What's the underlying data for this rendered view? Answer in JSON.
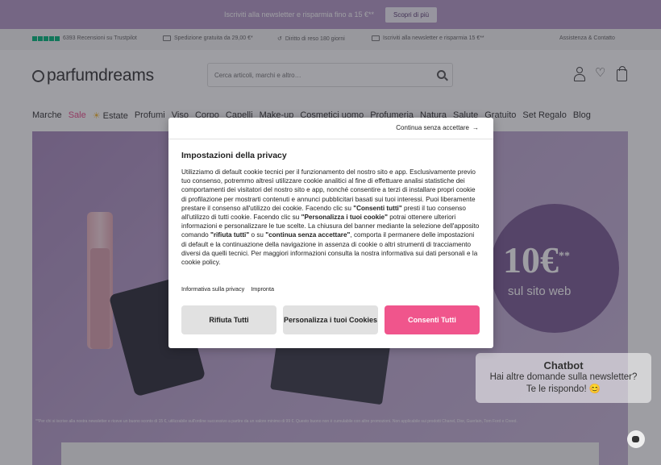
{
  "top_banner": {
    "text": "Iscriviti alla newsletter e risparmia fino a 15 €**",
    "button": "Scopri di più"
  },
  "info_bar": {
    "reviews": "6393 Recensioni su Trustpilot",
    "shipping": "Spedizione gratuita da 29,00 €*",
    "returns": "Diritto di reso 180 giorni",
    "newsletter": "Iscriviti alla newsletter e risparmia 15 €**",
    "support": "Assistenza & Contatto"
  },
  "header": {
    "logo": "parfumdreams",
    "search_placeholder": "Cerca articoli, marchi e altro…"
  },
  "nav": {
    "items": [
      "Marche",
      "Sale",
      "Estate",
      "Profumi",
      "Viso",
      "Corpo",
      "Capelli",
      "Make-up",
      "Cosmetici uomo",
      "Profumeria",
      "Natura",
      "Salute",
      "Gratuito",
      "Set Regalo",
      "Blog"
    ]
  },
  "hero": {
    "amount": "10€",
    "amount_sup": "**",
    "subtitle": "sul sito web",
    "fine_print": "**Per chi si iscrive alla nostra newsletter e riceve un buono sconto di 15 €, utilizzabile sull'ordine successivo a partire da un valore minimo di 99 €. Questo buono non è cumulabile con altre promozioni. Non applicabile sui prodotti Chanel, Dior, Guerlain, Tom Ford e Creed."
  },
  "chatbot": {
    "title": "Chatbot",
    "line1": "Hai altre domande sulla newsletter?",
    "line2": "Te le rispondo! 😊"
  },
  "modal": {
    "continue_link": "Continua senza accettare",
    "title": "Impostazioni della privacy",
    "body_1": "Utilizziamo di default cookie tecnici per il funzionamento del nostro sito e app. Esclusivamente previo tuo consenso, potremmo altresì utilizzare cookie analitici al fine di effettuare analisi statistiche dei comportamenti dei visitatori del nostro sito e app, nonché consentire a terzi di installare propri cookie di profilazione per mostrarti contenuti e annunci pubblicitari basati sui tuoi interessi. Puoi liberamente prestare il consenso all'utilizzo dei cookie. Facendo clic su ",
    "body_b1": "\"Consenti tutti\"",
    "body_2": " presti il tuo consenso all'utilizzo di tutti cookie. Facendo clic su ",
    "body_b2": "\"Personalizza i tuoi cookie\"",
    "body_3": " potrai ottenere ulteriori informazioni e personalizzare le tue scelte. La chiusura del banner mediante la selezione dell'apposito comando ",
    "body_b3": "\"rifiuta tutti\"",
    "body_4": " o su ",
    "body_b4": "\"continua senza accettare\"",
    "body_5": ", comporta il permanere delle impostazioni di default e la continuazione della navigazione in assenza di cookie o altri strumenti di tracciamento diversi da quelli tecnici. Per maggiori informazioni consulta la nostra informativa sui dati personali e la cookie policy.",
    "link_privacy": "Informativa sulla privacy",
    "link_imprint": "Impronta",
    "btn_reject": "Rifiuta Tutti",
    "btn_customize": "Personalizza i tuoi Cookies",
    "btn_accept": "Consenti Tutti"
  }
}
